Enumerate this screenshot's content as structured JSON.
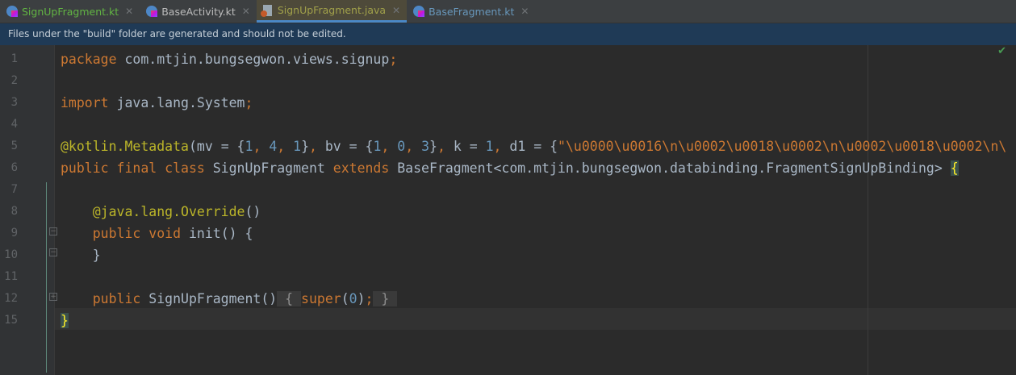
{
  "tabs": [
    {
      "label": "SignUpFragment.kt",
      "icon": "kotlin-file-icon",
      "color": "#62b543"
    },
    {
      "label": "BaseActivity.kt",
      "icon": "kotlin-file-icon",
      "color": "#bbbbbb"
    },
    {
      "label": "SignUpFragment.java",
      "icon": "java-class-file-icon",
      "color": "#a0a04a",
      "active": true
    },
    {
      "label": "BaseFragment.kt",
      "icon": "kotlin-file-icon",
      "color": "#6897bb"
    }
  ],
  "banner": "Files under the \"build\" folder are generated and should not be edited.",
  "lines": [
    {
      "n": "1",
      "tokens": [
        {
          "t": "package ",
          "c": "kw"
        },
        {
          "t": "com.mtjin.bungsegwon.views.signup",
          "c": "plain"
        },
        {
          "t": ";",
          "c": "kw"
        }
      ]
    },
    {
      "n": "2",
      "tokens": []
    },
    {
      "n": "3",
      "tokens": [
        {
          "t": "import ",
          "c": "kw"
        },
        {
          "t": "java.lang.System",
          "c": "plain"
        },
        {
          "t": ";",
          "c": "kw"
        }
      ]
    },
    {
      "n": "4",
      "tokens": []
    },
    {
      "n": "5",
      "tokens": [
        {
          "t": "@kotlin.Metadata",
          "c": "ann"
        },
        {
          "t": "(mv = {",
          "c": "plain"
        },
        {
          "t": "1",
          "c": "num"
        },
        {
          "t": ", ",
          "c": "kw"
        },
        {
          "t": "4",
          "c": "num"
        },
        {
          "t": ", ",
          "c": "kw"
        },
        {
          "t": "1",
          "c": "num"
        },
        {
          "t": "}",
          "c": "plain"
        },
        {
          "t": ", ",
          "c": "kw"
        },
        {
          "t": "bv = {",
          "c": "plain"
        },
        {
          "t": "1",
          "c": "num"
        },
        {
          "t": ", ",
          "c": "kw"
        },
        {
          "t": "0",
          "c": "num"
        },
        {
          "t": ", ",
          "c": "kw"
        },
        {
          "t": "3",
          "c": "num"
        },
        {
          "t": "}",
          "c": "plain"
        },
        {
          "t": ", ",
          "c": "kw"
        },
        {
          "t": "k = ",
          "c": "plain"
        },
        {
          "t": "1",
          "c": "num"
        },
        {
          "t": ", ",
          "c": "kw"
        },
        {
          "t": "d1 = {",
          "c": "plain"
        },
        {
          "t": "\"\\u0000\\u0016\\n\\u0002\\u0018\\u0002\\n\\u0002\\u0018\\u0002\\n\\",
          "c": "str"
        }
      ]
    },
    {
      "n": "6",
      "tokens": [
        {
          "t": "public final class ",
          "c": "kw"
        },
        {
          "t": "SignUpFragment ",
          "c": "plain"
        },
        {
          "t": "extends ",
          "c": "kw"
        },
        {
          "t": "BaseFragment<com.mtjin.bungsegwon.databinding.FragmentSignUpBinding> ",
          "c": "plain"
        },
        {
          "t": "{",
          "c": "brace"
        }
      ]
    },
    {
      "n": "7",
      "tokens": []
    },
    {
      "n": "8",
      "tokens": [
        {
          "t": "    @java.lang.Override",
          "c": "ann"
        },
        {
          "t": "()",
          "c": "plain"
        }
      ]
    },
    {
      "n": "9",
      "tokens": [
        {
          "t": "    public void ",
          "c": "kw"
        },
        {
          "t": "init() {",
          "c": "plain"
        }
      ]
    },
    {
      "n": "10",
      "tokens": [
        {
          "t": "    }",
          "c": "plain"
        }
      ]
    },
    {
      "n": "11",
      "tokens": []
    },
    {
      "n": "12",
      "tokens": [
        {
          "t": "    public ",
          "c": "kw"
        },
        {
          "t": "SignUpFragment()",
          "c": "plain"
        },
        {
          "t": " { ",
          "c": "fold"
        },
        {
          "t": "super",
          "c": "kw"
        },
        {
          "t": "(",
          "c": "plain"
        },
        {
          "t": "0",
          "c": "num"
        },
        {
          "t": ")",
          "c": "plain"
        },
        {
          "t": ";",
          "c": "kw"
        },
        {
          "t": " } ",
          "c": "fold"
        }
      ]
    },
    {
      "n": "15",
      "tokens": [
        {
          "t": "}",
          "c": "brace"
        }
      ]
    }
  ]
}
